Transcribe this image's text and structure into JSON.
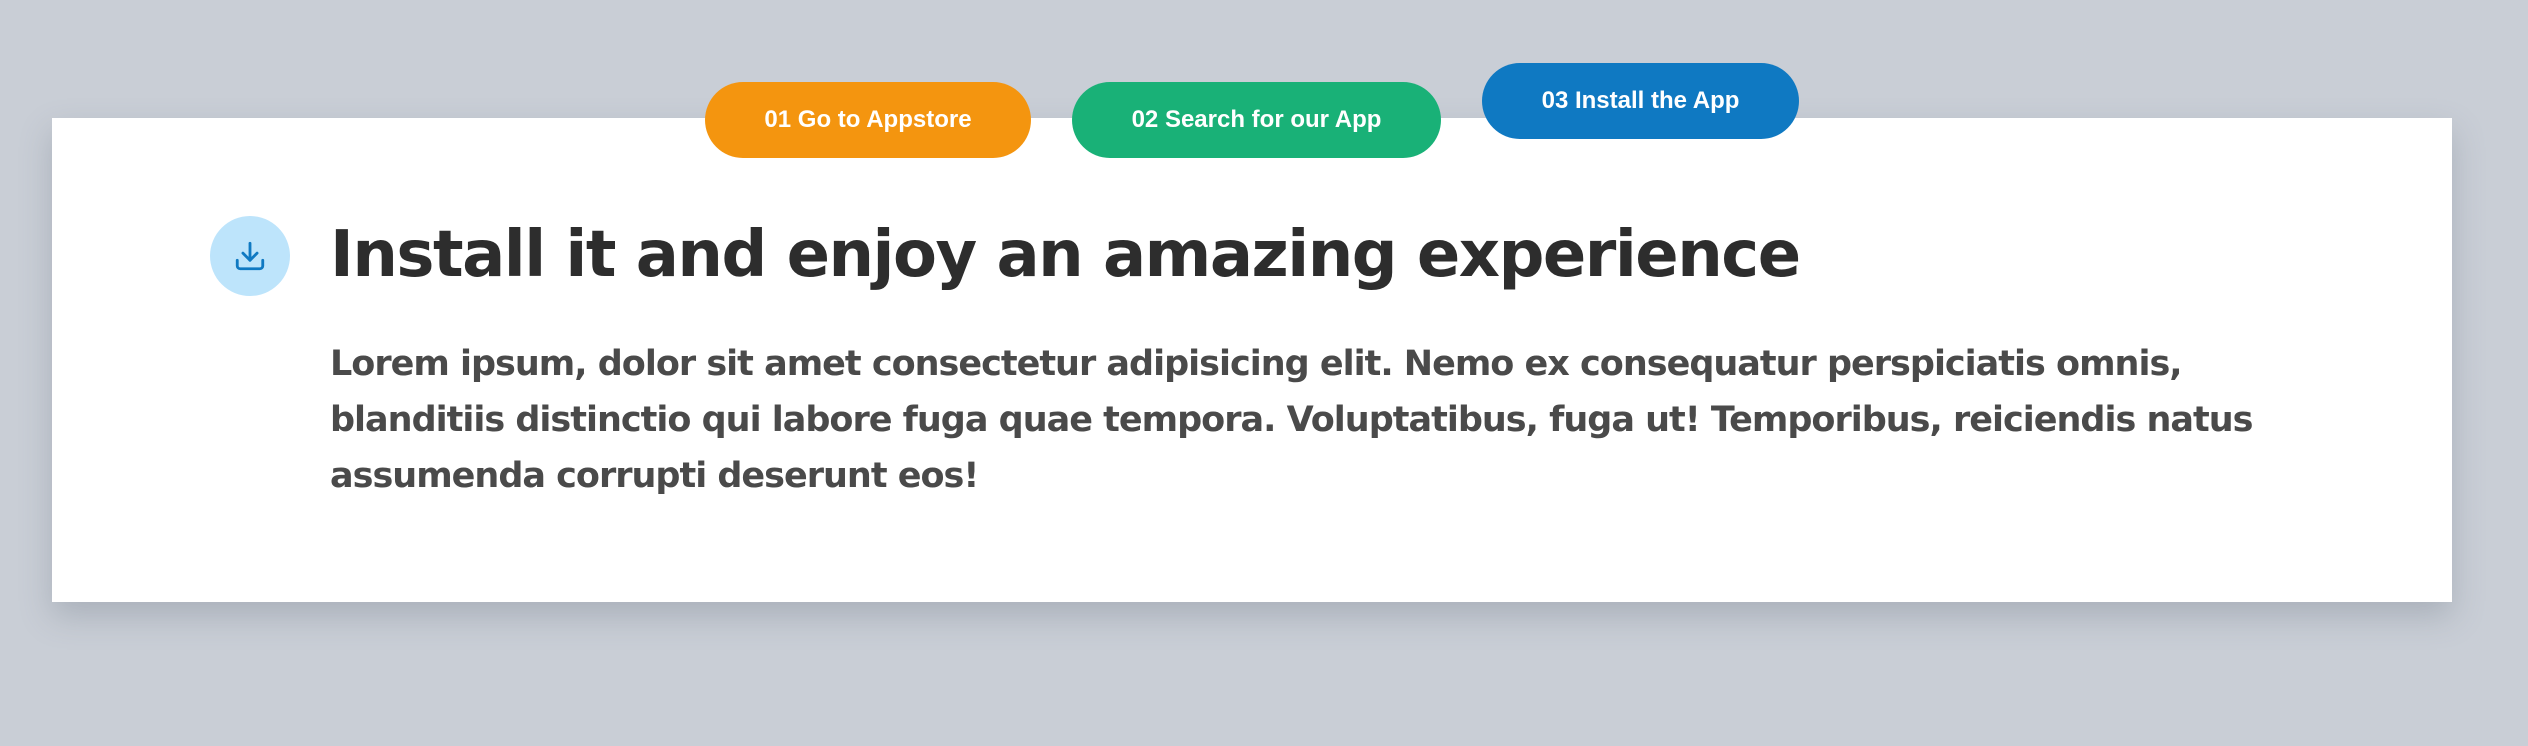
{
  "steps": [
    {
      "label": "01 Go to Appstore",
      "color": "#f4950f"
    },
    {
      "label": "02 Search for our App",
      "color": "#19b177"
    },
    {
      "label": "03 Install the App",
      "color": "#0f79c2",
      "active": true
    }
  ],
  "content": {
    "icon": "download-icon",
    "title": "Install it and enjoy an amazing experience",
    "body": "Lorem ipsum, dolor sit amet consectetur adipisicing elit. Nemo ex consequatur perspiciatis omnis, blanditiis distinctio qui labore fuga quae tempora. Voluptatibus, fuga ut! Temporibus, reiciendis natus assumenda corrupti deserunt eos!"
  },
  "colors": {
    "page_background": "#c9ced6",
    "card_background": "#ffffff",
    "icon_circle": "#bde4fb",
    "icon_stroke": "#0f79c2",
    "title_text": "#2d2d2d",
    "body_text": "#4a4a4a"
  }
}
